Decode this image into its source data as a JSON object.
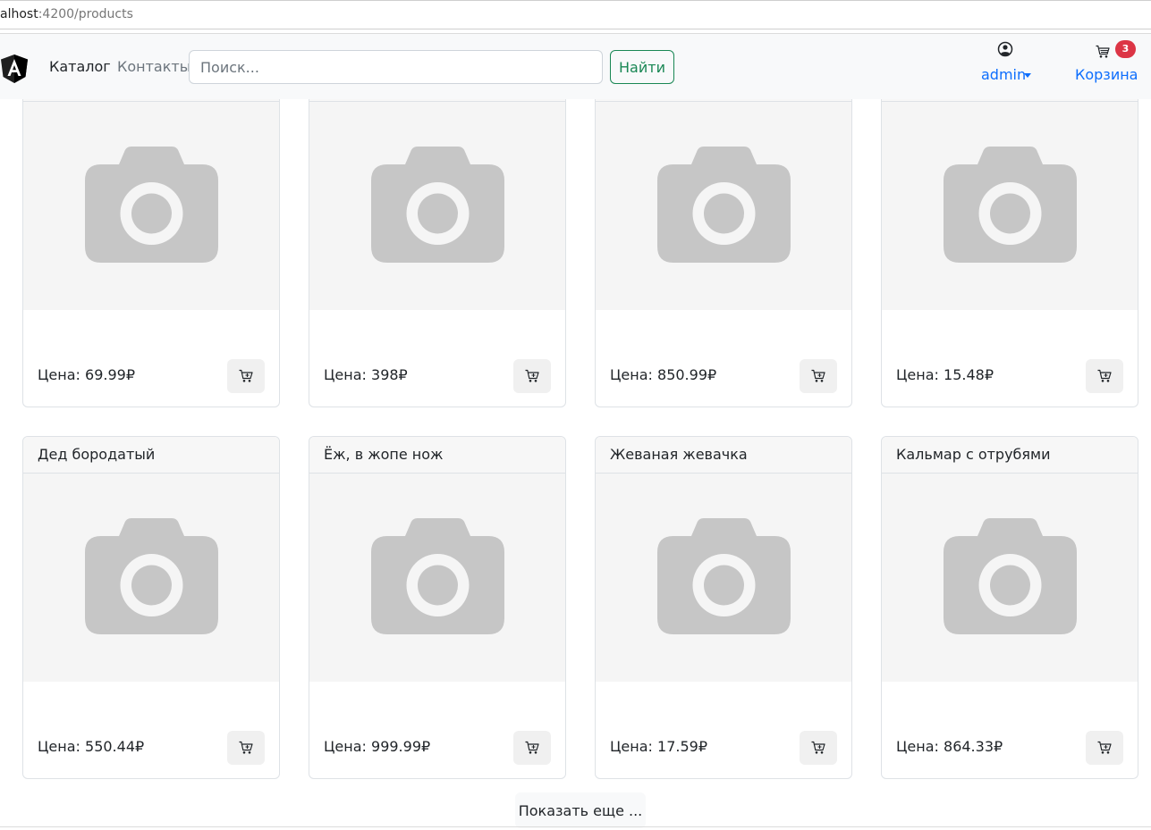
{
  "browser": {
    "url_host": "alhost",
    "url_path": ":4200/products"
  },
  "navbar": {
    "catalog_label": "Каталог",
    "contacts_label": "Контакты",
    "search_placeholder": "Поиск...",
    "search_button": "Найти",
    "user_name": "admin",
    "cart_label": "Корзина",
    "cart_count": "3"
  },
  "products": [
    {
      "title": "",
      "price": "Цена: 69.99₽"
    },
    {
      "title": "",
      "price": "Цена: 398₽"
    },
    {
      "title": "",
      "price": "Цена: 850.99₽"
    },
    {
      "title": "",
      "price": "Цена: 15.48₽"
    },
    {
      "title": "Дед бородатый",
      "price": "Цена: 550.44₽"
    },
    {
      "title": "Ёж, в жопе нож",
      "price": "Цена: 999.99₽"
    },
    {
      "title": "Жеваная жевачка",
      "price": "Цена: 17.59₽"
    },
    {
      "title": "Кальмар с отрубями",
      "price": "Цена: 864.33₽"
    }
  ],
  "show_more": "Показать еще ...",
  "colors": {
    "primary": "#0d6efd",
    "success": "#198754",
    "danger": "#dc3545",
    "navbar_bg": "#f8f9fa"
  },
  "icons": {
    "logo": "angular-logo-icon",
    "user": "person-circle-icon",
    "cart": "cart-icon",
    "placeholder": "camera-icon"
  }
}
